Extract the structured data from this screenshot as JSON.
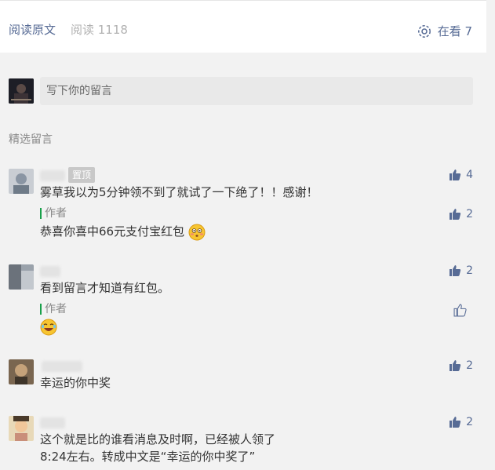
{
  "header": {
    "read_original": "阅读原文",
    "read_count": "阅读 1118",
    "watching_label": "在看 7"
  },
  "composer": {
    "placeholder": "写下你的留言"
  },
  "section_title": "精选留言",
  "comments": [
    {
      "pin_label": "置顶",
      "text": "雾草我以为5分钟领不到了就试了一下绝了！！感谢！",
      "likes": "4",
      "reply": {
        "author_label": "作者",
        "text": "恭喜你喜中66元支付宝红包",
        "likes": "2"
      }
    },
    {
      "text": "看到留言才知道有红包。",
      "likes": "2",
      "reply": {
        "author_label": "作者",
        "likes": ""
      }
    },
    {
      "text": "幸运的你中奖",
      "likes": "2"
    },
    {
      "text_line1": "这个就是比的谁看消息及时啊，已经被人领了",
      "text_line2": "8:24左右。转成中文是“幸运的你中奖了”",
      "likes": "2"
    }
  ],
  "colors": {
    "link": "#576b95",
    "author_bar": "#19a04a",
    "bg": "#f2f2f2"
  },
  "icons": [
    "gear-icon",
    "thumb-up-icon",
    "blush-emoji-icon",
    "laugh-emoji-icon"
  ]
}
